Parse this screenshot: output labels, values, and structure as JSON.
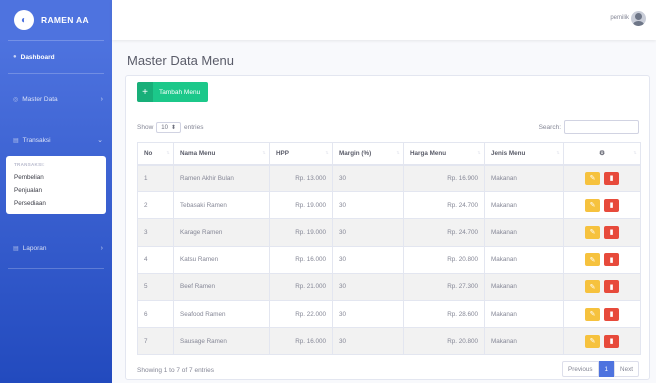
{
  "brand": {
    "name": "RAMEN AA"
  },
  "sidebar": {
    "items": [
      {
        "label": "Dashboard"
      },
      {
        "label": "Master Data"
      },
      {
        "label": "Transaksi"
      },
      {
        "label": "Laporan"
      }
    ],
    "submenu": {
      "header": "TRANSAKSI:",
      "items": [
        "Pembelian",
        "Penjualan",
        "Persediaan"
      ]
    }
  },
  "topbar": {
    "user_name": "pemilik"
  },
  "page": {
    "title": "Master Data Menu"
  },
  "toolbar": {
    "add_label": "Tambah Menu",
    "add_icon": "+"
  },
  "table_controls": {
    "show_label": "Show",
    "length_value": "10",
    "entries_label": "entries",
    "search_label": "Search:"
  },
  "table": {
    "columns": [
      "No",
      "Nama Menu",
      "HPP",
      "Margin (%)",
      "Harga Menu",
      "Jenis Menu",
      "⚙"
    ],
    "rows": [
      {
        "no": "1",
        "nama": "Ramen Akhir Bulan",
        "hpp": "Rp. 13.000",
        "margin": "30",
        "harga": "Rp. 16.900",
        "jenis": "Makanan"
      },
      {
        "no": "2",
        "nama": "Tebasaki Ramen",
        "hpp": "Rp. 19.000",
        "margin": "30",
        "harga": "Rp. 24.700",
        "jenis": "Makanan"
      },
      {
        "no": "3",
        "nama": "Karage Ramen",
        "hpp": "Rp. 19.000",
        "margin": "30",
        "harga": "Rp. 24.700",
        "jenis": "Makanan"
      },
      {
        "no": "4",
        "nama": "Katsu Ramen",
        "hpp": "Rp. 16.000",
        "margin": "30",
        "harga": "Rp. 20.800",
        "jenis": "Makanan"
      },
      {
        "no": "5",
        "nama": "Beef Ramen",
        "hpp": "Rp. 21.000",
        "margin": "30",
        "harga": "Rp. 27.300",
        "jenis": "Makanan"
      },
      {
        "no": "6",
        "nama": "Seafood Ramen",
        "hpp": "Rp. 22.000",
        "margin": "30",
        "harga": "Rp. 28.600",
        "jenis": "Makanan"
      },
      {
        "no": "7",
        "nama": "Sausage Ramen",
        "hpp": "Rp. 16.000",
        "margin": "30",
        "harga": "Rp. 20.800",
        "jenis": "Makanan"
      }
    ]
  },
  "footer": {
    "info": "Showing 1 to 7 of 7 entries",
    "previous": "Previous",
    "current_page": "1",
    "next": "Next"
  },
  "colors": {
    "sidebar": "#4e73df",
    "add_button": "#1cc88a",
    "edit_button": "#f6c23e",
    "delete_button": "#e74a3b"
  },
  "icons": {
    "brand": "ramen-logo-icon",
    "dashboard": "tachometer-icon",
    "settings": "gear-icon",
    "edit": "edit-icon",
    "delete": "trash-icon"
  }
}
